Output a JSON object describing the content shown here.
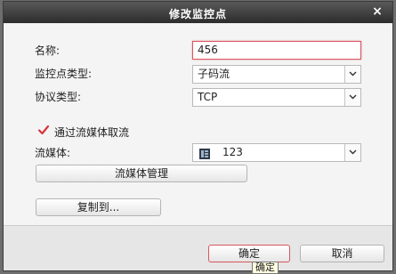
{
  "dialog": {
    "title": "修改监控点",
    "close_glyph": "×"
  },
  "form": {
    "name_label": "名称:",
    "name_value": "456",
    "type_label": "监控点类型:",
    "type_value": "子码流",
    "protocol_label": "协议类型:",
    "protocol_value": "TCP",
    "via_stream_label": "通过流媒体取流",
    "via_stream_checked": true,
    "stream_label": "流媒体:",
    "stream_value": "123",
    "stream_manage_button": "流媒体管理",
    "copy_to_button": "复制到..."
  },
  "footer": {
    "ok_button": "确定",
    "cancel_button": "取消"
  },
  "tooltip": {
    "text": "确定"
  },
  "colors": {
    "titlebar": "#2c2c2c",
    "accent_border": "#d8565e",
    "check": "#d8343e"
  },
  "icons": {
    "close": "close-icon",
    "dropdown": "chevron-down-icon",
    "check": "checkmark-icon",
    "stream_server": "server-icon"
  }
}
